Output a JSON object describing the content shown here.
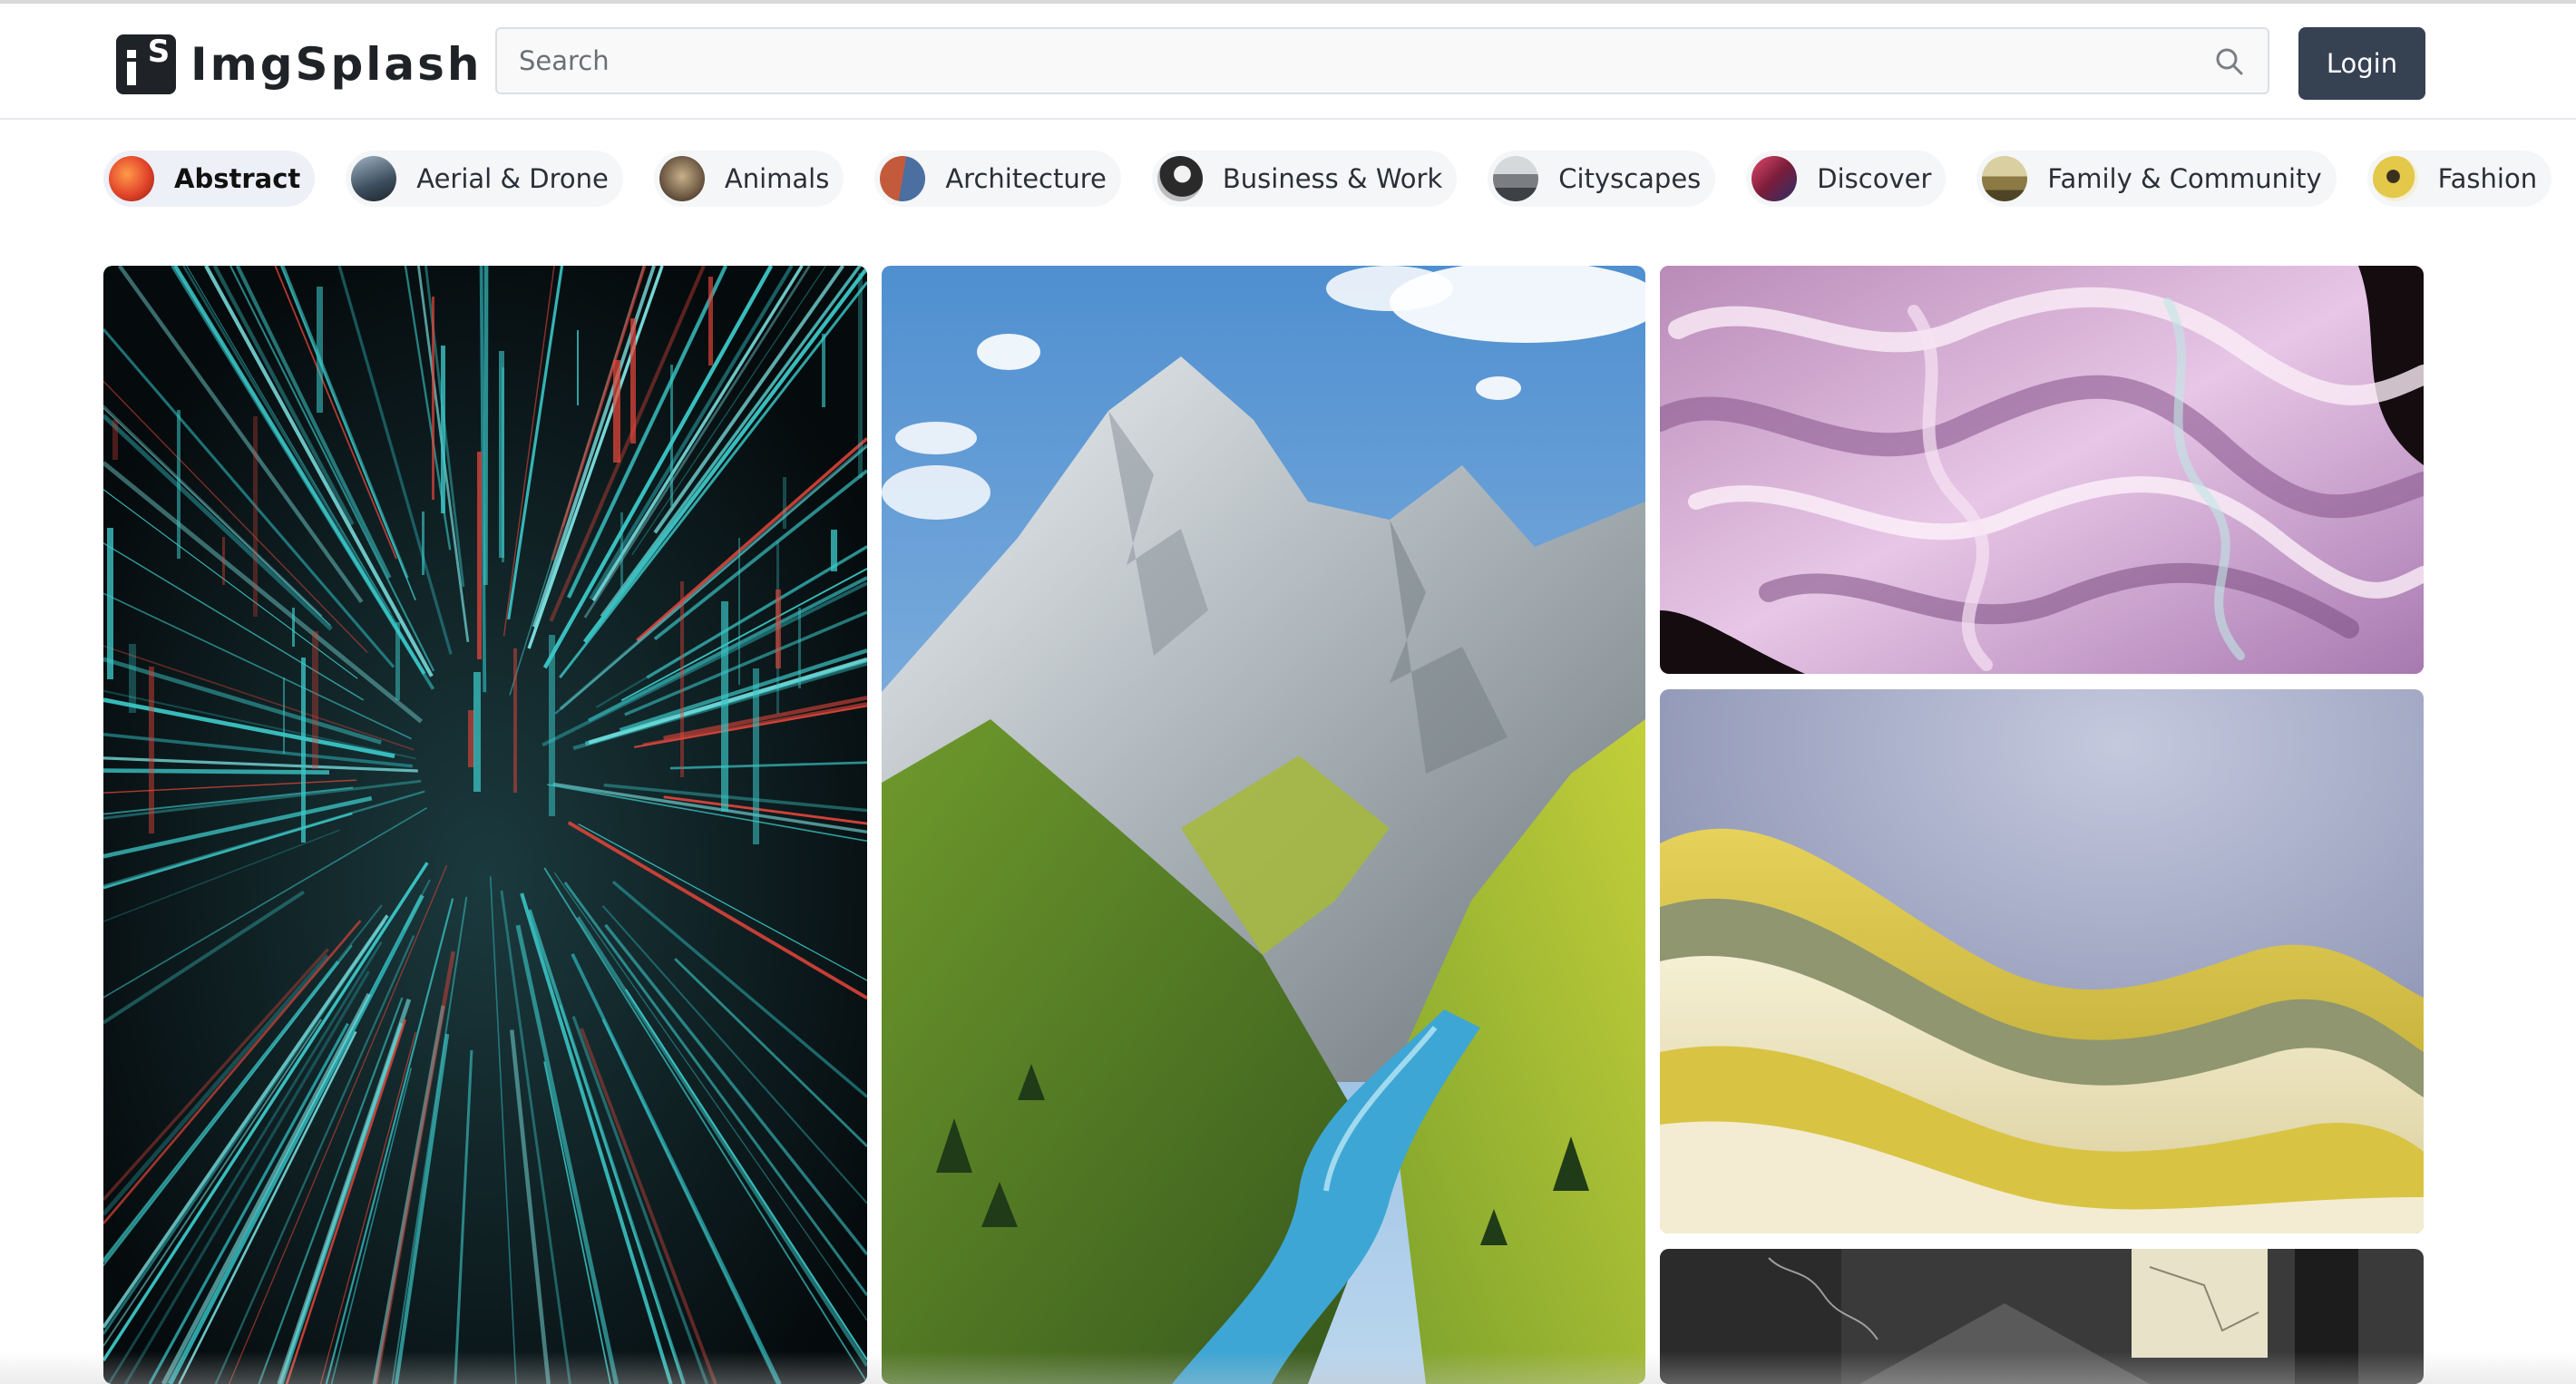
{
  "app": {
    "name": "ImgSplash",
    "logo_letter": "S"
  },
  "search": {
    "placeholder": "Search",
    "icon": "search-icon"
  },
  "header": {
    "login_label": "Login"
  },
  "categories": [
    {
      "label": "Abstract",
      "active": true,
      "avatar_color": "#e2442a"
    },
    {
      "label": "Aerial & Drone",
      "active": false,
      "avatar_color": "#3e4e5e"
    },
    {
      "label": "Animals",
      "active": false,
      "avatar_color": "#6e5a45"
    },
    {
      "label": "Architecture",
      "active": false,
      "avatar_color": "#c45a3c"
    },
    {
      "label": "Business & Work",
      "active": false,
      "avatar_color": "#2a2a2a"
    },
    {
      "label": "Cityscapes",
      "active": false,
      "avatar_color": "#7a7e82"
    },
    {
      "label": "Discover",
      "active": false,
      "avatar_color": "#7b1d3a"
    },
    {
      "label": "Family & Community",
      "active": false,
      "avatar_color": "#8c7a44"
    },
    {
      "label": "Fashion",
      "active": false,
      "avatar_color": "#e3c84a"
    }
  ],
  "gallery": [
    {
      "subject": "abstract-digital-tunnel",
      "colors": [
        "#0c1418",
        "#3cc8c8",
        "#e0453a"
      ]
    },
    {
      "subject": "mountain-valley-river",
      "colors": [
        "#6fa3d8",
        "#c9ced1",
        "#5c8a2e",
        "#b7c43a",
        "#3a9cc8"
      ]
    },
    {
      "subject": "iridescent-pink-fabric",
      "colors": [
        "#d8a8d8",
        "#f3def0",
        "#1a1014"
      ]
    },
    {
      "subject": "yellow-cream-waves",
      "colors": [
        "#8d95b8",
        "#e0cf4c",
        "#f1e9c6",
        "#8f9670"
      ]
    },
    {
      "subject": "dark-gray-artwork",
      "colors": [
        "#2d2d2d",
        "#575757",
        "#e8e2c8"
      ]
    }
  ]
}
